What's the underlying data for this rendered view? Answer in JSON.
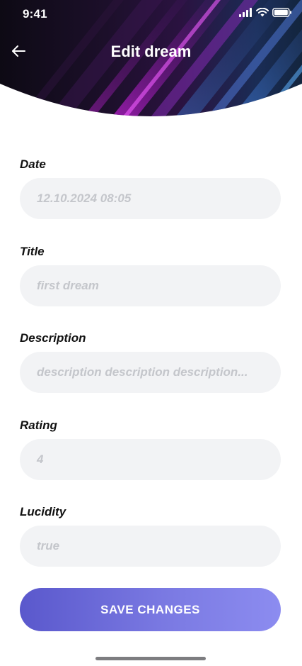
{
  "status_bar": {
    "time": "9:41",
    "icons": [
      "signal-icon",
      "wifi-icon",
      "battery-icon"
    ]
  },
  "header": {
    "back_icon": "arrow-left-icon",
    "title": "Edit dream"
  },
  "form": {
    "fields": [
      {
        "label": "Date",
        "value": "12.10.2024 08:05"
      },
      {
        "label": "Title",
        "value": "first dream"
      },
      {
        "label": "Description",
        "value": "description description description..."
      },
      {
        "label": "Rating",
        "value": "4"
      },
      {
        "label": "Lucidity",
        "value": "true"
      }
    ]
  },
  "actions": {
    "save_label": "SAVE CHANGES"
  },
  "colors": {
    "accent_start": "#5a58cc",
    "accent_end": "#8c8cf0",
    "input_bg": "#f2f3f5",
    "placeholder": "#c4c6cb"
  }
}
